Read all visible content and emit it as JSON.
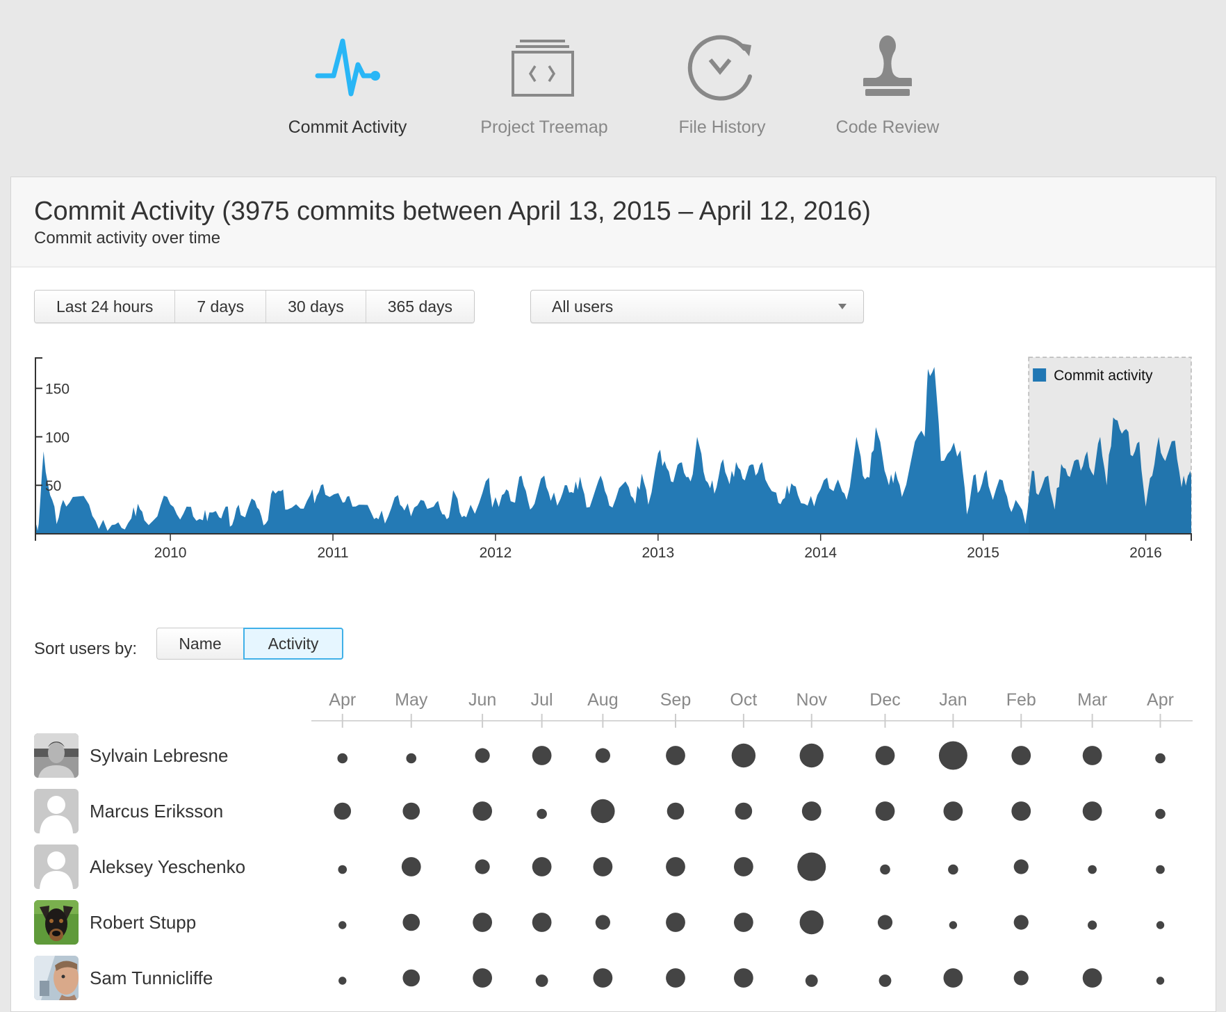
{
  "nav": [
    {
      "label": "Commit Activity",
      "icon": "pulse-icon",
      "active": true,
      "color": "#29b6f6"
    },
    {
      "label": "Project Treemap",
      "icon": "code-window-icon",
      "active": false,
      "color": "#888888"
    },
    {
      "label": "File History",
      "icon": "history-clock-icon",
      "active": false,
      "color": "#888888"
    },
    {
      "label": "Code Review",
      "icon": "stamp-icon",
      "active": false,
      "color": "#888888"
    }
  ],
  "panel": {
    "title": "Commit Activity (3975 commits between April 13, 2015 – April 12, 2016)",
    "subtitle": "Commit activity over time"
  },
  "range_buttons": [
    "Last 24 hours",
    "7 days",
    "30 days",
    "365 days"
  ],
  "user_select": {
    "value": "All users"
  },
  "sort": {
    "label": "Sort users by:",
    "options": [
      "Name",
      "Activity"
    ],
    "selected": "Activity"
  },
  "chart_data": {
    "type": "area",
    "title": "",
    "xlabel": "",
    "ylabel": "",
    "series": [
      {
        "name": "Commit activity",
        "color": "#2077b4"
      }
    ],
    "legend": {
      "label": "Commit activity",
      "position": "top-right"
    },
    "x_ticks": [
      "2010",
      "2011",
      "2012",
      "2013",
      "2014",
      "2015",
      "2016"
    ],
    "y_ticks": [
      50,
      100,
      150
    ],
    "xlim": [
      2009.17,
      2016.28
    ],
    "ylim": [
      0,
      172
    ],
    "highlight_range": [
      2015.28,
      2016.28
    ],
    "keypoints": [
      [
        2009.17,
        0
      ],
      [
        2009.19,
        10
      ],
      [
        2009.22,
        85
      ],
      [
        2009.26,
        40
      ],
      [
        2009.3,
        10
      ],
      [
        2009.34,
        35
      ],
      [
        2009.4,
        38
      ],
      [
        2009.5,
        30
      ],
      [
        2009.56,
        5
      ],
      [
        2009.64,
        9
      ],
      [
        2009.7,
        6
      ],
      [
        2009.76,
        16
      ],
      [
        2009.8,
        31
      ],
      [
        2009.84,
        14
      ],
      [
        2009.92,
        18
      ],
      [
        2009.98,
        38
      ],
      [
        2010.04,
        20
      ],
      [
        2010.1,
        28
      ],
      [
        2010.14,
        18
      ],
      [
        2010.2,
        14
      ],
      [
        2010.24,
        22
      ],
      [
        2010.3,
        17
      ],
      [
        2010.34,
        28
      ],
      [
        2010.38,
        9
      ],
      [
        2010.42,
        30
      ],
      [
        2010.46,
        17
      ],
      [
        2010.52,
        34
      ],
      [
        2010.56,
        18
      ],
      [
        2010.6,
        14
      ],
      [
        2010.63,
        45
      ],
      [
        2010.68,
        44
      ],
      [
        2010.72,
        25
      ],
      [
        2010.8,
        26
      ],
      [
        2010.86,
        40
      ],
      [
        2010.9,
        39
      ],
      [
        2010.94,
        51
      ],
      [
        2010.98,
        38
      ],
      [
        2011.06,
        32
      ],
      [
        2011.1,
        39
      ],
      [
        2011.16,
        30
      ],
      [
        2011.24,
        20
      ],
      [
        2011.28,
        15
      ],
      [
        2011.34,
        18
      ],
      [
        2011.4,
        40
      ],
      [
        2011.44,
        24
      ],
      [
        2011.5,
        27
      ],
      [
        2011.56,
        34
      ],
      [
        2011.62,
        28
      ],
      [
        2011.66,
        25
      ],
      [
        2011.7,
        15
      ],
      [
        2011.74,
        45
      ],
      [
        2011.78,
        22
      ],
      [
        2011.82,
        17
      ],
      [
        2011.9,
        32
      ],
      [
        2011.96,
        58
      ],
      [
        2011.98,
        27
      ],
      [
        2012.04,
        40
      ],
      [
        2012.08,
        44
      ],
      [
        2012.12,
        32
      ],
      [
        2012.16,
        60
      ],
      [
        2012.2,
        34
      ],
      [
        2012.24,
        31
      ],
      [
        2012.3,
        60
      ],
      [
        2012.34,
        34
      ],
      [
        2012.4,
        36
      ],
      [
        2012.44,
        50
      ],
      [
        2012.48,
        42
      ],
      [
        2012.52,
        59
      ],
      [
        2012.56,
        27
      ],
      [
        2012.62,
        48
      ],
      [
        2012.66,
        54
      ],
      [
        2012.7,
        29
      ],
      [
        2012.76,
        47
      ],
      [
        2012.82,
        48
      ],
      [
        2012.86,
        31
      ],
      [
        2012.9,
        62
      ],
      [
        2012.94,
        30
      ],
      [
        2013.0,
        83
      ],
      [
        2013.04,
        75
      ],
      [
        2013.08,
        54
      ],
      [
        2013.12,
        71
      ],
      [
        2013.16,
        63
      ],
      [
        2013.2,
        54
      ],
      [
        2013.24,
        100
      ],
      [
        2013.28,
        64
      ],
      [
        2013.32,
        47
      ],
      [
        2013.36,
        48
      ],
      [
        2013.4,
        77
      ],
      [
        2013.44,
        51
      ],
      [
        2013.48,
        74
      ],
      [
        2013.52,
        57
      ],
      [
        2013.56,
        70
      ],
      [
        2013.6,
        60
      ],
      [
        2013.64,
        74
      ],
      [
        2013.7,
        44
      ],
      [
        2013.74,
        32
      ],
      [
        2013.78,
        37
      ],
      [
        2013.82,
        52
      ],
      [
        2013.86,
        40
      ],
      [
        2013.92,
        29
      ],
      [
        2013.98,
        40
      ],
      [
        2014.04,
        58
      ],
      [
        2014.08,
        44
      ],
      [
        2014.12,
        50
      ],
      [
        2014.16,
        35
      ],
      [
        2014.22,
        100
      ],
      [
        2014.26,
        60
      ],
      [
        2014.3,
        58
      ],
      [
        2014.34,
        110
      ],
      [
        2014.38,
        80
      ],
      [
        2014.42,
        50
      ],
      [
        2014.46,
        65
      ],
      [
        2014.5,
        38
      ],
      [
        2014.58,
        95
      ],
      [
        2014.64,
        100
      ],
      [
        2014.66,
        170
      ],
      [
        2014.7,
        172
      ],
      [
        2014.74,
        75
      ],
      [
        2014.8,
        86
      ],
      [
        2014.86,
        86
      ],
      [
        2014.9,
        20
      ],
      [
        2014.94,
        60
      ],
      [
        2014.98,
        45
      ],
      [
        2015.02,
        66
      ],
      [
        2015.06,
        35
      ],
      [
        2015.12,
        55
      ],
      [
        2015.16,
        28
      ],
      [
        2015.2,
        35
      ],
      [
        2015.26,
        10
      ],
      [
        2015.3,
        65
      ],
      [
        2015.34,
        40
      ],
      [
        2015.4,
        60
      ],
      [
        2015.44,
        25
      ],
      [
        2015.48,
        72
      ],
      [
        2015.52,
        60
      ],
      [
        2015.56,
        75
      ],
      [
        2015.6,
        65
      ],
      [
        2015.64,
        85
      ],
      [
        2015.68,
        60
      ],
      [
        2015.72,
        100
      ],
      [
        2015.76,
        50
      ],
      [
        2015.8,
        120
      ],
      [
        2015.84,
        108
      ],
      [
        2015.88,
        108
      ],
      [
        2015.92,
        80
      ],
      [
        2015.96,
        95
      ],
      [
        2016.0,
        28
      ],
      [
        2016.04,
        60
      ],
      [
        2016.08,
        100
      ],
      [
        2016.12,
        75
      ],
      [
        2016.18,
        96
      ],
      [
        2016.22,
        48
      ],
      [
        2016.26,
        60
      ],
      [
        2016.28,
        60
      ]
    ]
  },
  "users_chart": {
    "months": [
      "Apr",
      "May",
      "Jun",
      "Jul",
      "Aug",
      "Sep",
      "Oct",
      "Nov",
      "Dec",
      "Jan",
      "Feb",
      "Mar",
      "Apr"
    ],
    "users": [
      {
        "name": "Sylvain Lebresne",
        "avatar": "photo-bw",
        "activity": [
          1,
          1,
          2,
          3,
          2,
          3,
          4,
          4,
          3,
          5,
          3,
          3,
          1
        ]
      },
      {
        "name": "Marcus Eriksson",
        "avatar": "placeholder",
        "activity": [
          2.5,
          2.5,
          3,
          1,
          4,
          2.5,
          2.5,
          3,
          3,
          3,
          3,
          3,
          1
        ]
      },
      {
        "name": "Aleksey Yeschenko",
        "avatar": "placeholder",
        "activity": [
          0.7,
          3,
          2,
          3,
          3,
          3,
          3,
          5,
          1,
          1,
          2,
          0.7,
          0.7
        ]
      },
      {
        "name": "Robert Stupp",
        "avatar": "photo-dog",
        "activity": [
          0.5,
          2.5,
          3,
          3,
          2,
          3,
          3,
          4,
          2,
          0.5,
          2,
          0.8,
          0.5
        ]
      },
      {
        "name": "Sam Tunnicliffe",
        "avatar": "photo-man",
        "activity": [
          0.5,
          2.5,
          3,
          1.5,
          3,
          3,
          3,
          1.5,
          1.5,
          3,
          2,
          3,
          0.5
        ]
      }
    ]
  }
}
